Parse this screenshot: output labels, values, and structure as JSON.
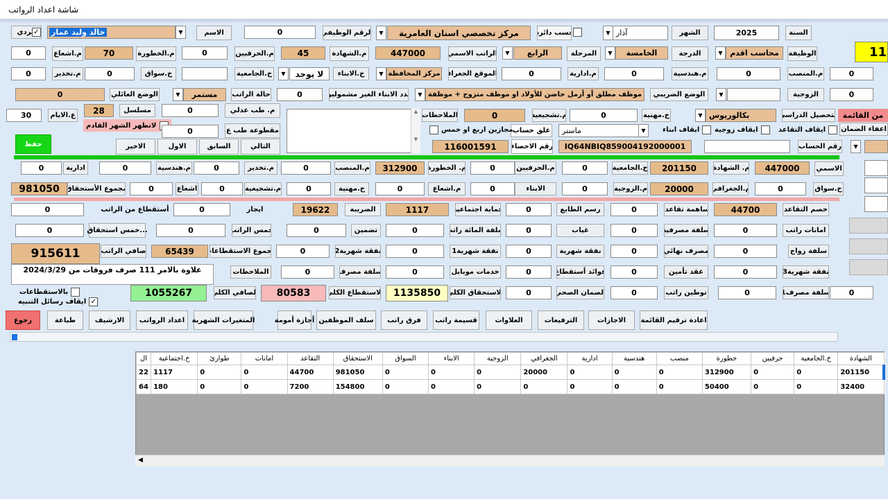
{
  "window": {
    "title": "شاشة اعداد الرواتب"
  },
  "top": {
    "year_label": "السنة",
    "year": "2025",
    "month_label": "الشهر",
    "month": "آذار",
    "by_circle_label": "حسب دائرة",
    "dept": "مركز تخصصي اسنان العامرية",
    "job_no_label": "الرقم الوظيفي",
    "job_no": "0",
    "name_label": "الاسم",
    "name": "خالد وليد عمار",
    "individual_label": "فردي",
    "big_counter": "11"
  },
  "row2": {
    "job_label": "الوظيفة",
    "job": "محاسب اقدم",
    "grade_label": "الدرجة",
    "grade": "الخامسة",
    "stage_label": "المرحلة",
    "stage": "الرابع",
    "nominal_label": "الراتب الاسمي",
    "nominal": "447000",
    "cert_label": "م.الشهادة",
    "cert": "45",
    "crafts_label": "م.الحرفيين",
    "crafts": "0",
    "danger_label": "م.الخطورة",
    "danger": "70",
    "radiation_label": "م.اشعاع",
    "radiation": "0"
  },
  "row3": {
    "pos_label": "م.المنصب",
    "pos": "0",
    "pos_left": "0",
    "eng_label": "م.هندسية",
    "eng": "0",
    "admin_label": "م.ادارية",
    "admin": "0",
    "geo_label": "م.الموقع الجغرافي",
    "geo": "مركز المحافظة",
    "kids_label": "خ.الابناء",
    "kids": "لا يوجد",
    "univ_label": "خ.الجامعية",
    "driver_label": "خ.سواق",
    "driver": "0",
    "anesth_label": "م.تخدير",
    "anesth": "0",
    "anesth2": "0"
  },
  "row4": {
    "spouse_label": "الزوجية",
    "spouse": "0",
    "tax_label": "الوضع الضريبي",
    "tax_status": "موظف مطلق أو أرمل حاضن للأولاد او موظف متزوج + موظفة",
    "kids_not_label": "عدد الابناء الغير مشمولين",
    "kids_not": "0",
    "salary_state_label": "حالة الراتب",
    "salary_state": "مستمر",
    "family_label": "الوضع العائلي",
    "family": "0"
  },
  "row5": {
    "edu_label": "التحصيل الدراسي",
    "edu": "بكالوريوس",
    "prof_label": "خ.مهنية",
    "prof": "0",
    "encour_label": "م.تشجيعية",
    "encour": "0",
    "notes_label": "الملاحظات",
    "judicial_label": "م. طب عدلي",
    "judicial": "0",
    "serial_label": "مسلسل",
    "serial": "28",
    "days_label": "ع.الايام",
    "days": "30",
    "hide_prev_label": "لاتظهر الشهر القادم",
    "cut_label": "مقطوعة طب ع",
    "cut": "0",
    "exempt_label": "اعفاء الضمان",
    "list_tag": "من القائمة"
  },
  "row6": {
    "stop_ret_label": "ايقاف التقاعد",
    "stop_spouse_label": "ايقاف زوجية",
    "stop_kids_label": "ايقاف ابناء",
    "degree2": "ماستر",
    "close_calc_label": "غلق حساب",
    "leave_label": "مجازين اربع او خمس",
    "account_label": "رقم الحساب",
    "iban": "IQ64NBIQ859004192000001",
    "stat_label": "رقم الاحصاء",
    "stat": "116001591"
  },
  "nav": {
    "save": "حفظ",
    "next": "التالي",
    "prev": "السابق",
    "first": "الاول",
    "last": "الاخير"
  },
  "calc1": {
    "nominal_label": "الاسمي",
    "nominal": "447000",
    "cert_label": "م. الشهادة",
    "cert": "201150",
    "univ_label": "خ.الجامعية",
    "univ": "0",
    "crafts_label": "م.الحرفيين",
    "crafts": "0",
    "danger_label": "م. الخطورة",
    "danger": "312900",
    "pos_label": "م.المنصب",
    "pos": "0",
    "anesth_label": "م.تخدير",
    "anesth": "0",
    "eng_label": "م.هندسية",
    "eng": "0",
    "admin_label": "ادارية",
    "admin": "0"
  },
  "calc2": {
    "driver_label": "خ.سواق",
    "driver": "0",
    "geo_label": "م.الجغرافي",
    "geo": "20000",
    "spouse_label": "م.الزوجية",
    "spouse": "0",
    "kids_label": "الابناء",
    "kids": "0",
    "radiation_label": "م.اشعاع",
    "radiation": "0",
    "prof_label": "خ.مهنية",
    "prof": "0",
    "encour_label": "م.تشجيعية",
    "encour": "0",
    "rad2_label": "اشعاع",
    "rad2": "0",
    "total_label": "مجموع الأستحقاق",
    "total": "981050"
  },
  "ded": {
    "retire_label": "خصم التقاعد",
    "retire": "44700",
    "retire_contrib_label": "مساهمة تقاعدية",
    "retire_contrib": "0",
    "stamp_label": "رسم الطابع",
    "stamp": "0",
    "social_label": "حماية اجتماعية",
    "social": "1117",
    "tax_label": "الضريبة",
    "tax": "19622",
    "rent_label": "ايجار",
    "rent": "0",
    "salary_ded_label": "أستقطاع من الراتب",
    "salary_ded": "0",
    "trust_label": "امانات راتب",
    "trust": "0",
    "bank_loan_label": "سلفة مصرفية",
    "bank_loan": "0",
    "absence_label": "غياب",
    "absence": "0",
    "loan100_label": "سلفة المائة راتب",
    "loan100": "0",
    "insure_label": "تضمين",
    "insure": "0",
    "fifth_label": "خمس الراتب",
    "fifth": "0",
    "fifth_due_label": "خمس استحقاق...",
    "fifth_due": "0",
    "marriage_label": "سلفة زواج",
    "marriage": "0",
    "final_exp_label": "مصرف نهائي",
    "final_exp": "0",
    "monthly_label": "نفقة شهرية",
    "monthly": "0",
    "monthly1_label": "نفقة شهرية1",
    "monthly1": "0",
    "monthly2_label": "نفقة شهرية2",
    "monthly2": "0",
    "total_ded_label": "مجموع الاستقطاعات",
    "total_ded": "65439",
    "net_label": "صافي الراتب",
    "net": "915611",
    "monthly3_label": "نفقة شهرية3",
    "monthly3": "0",
    "ins_contract_label": "عقد تأمين",
    "ins_contract": "0",
    "ded_interest_label": "فوائد أستقطاع",
    "ded_interest": "0",
    "mobile_label": "خدمات موبايل",
    "mobile": "0",
    "bank_exp_label": "سلفة مصرف",
    "bank_exp": "0",
    "notes_label": "الملاحظات",
    "note": "علاوة بالامر 111 صرف فروقات من 2024/3/29",
    "loan1_label": "سلفة مصرف1",
    "loan1": "0",
    "loan1_b": "0",
    "localize_label": "توطين راتب",
    "localize": "0",
    "health_label": "الضمان الصحي",
    "health": "0",
    "total_due_label": "الاستحقاق الكلي",
    "total_due": "1135850",
    "total_ded2_label": "الاستقطاع الكلي",
    "total_ded2": "80583",
    "total_net_label": "الصافي الكلي",
    "total_net": "1055267",
    "with_ded_label": "بالاستقطاعات",
    "stop_alerts_label": "ايقاف رسائل التنبيه"
  },
  "actions": [
    "اعادة ترقيم القائمة",
    "الاجازات",
    "الترفيعات",
    "العلاوات",
    "قسيمة راتب",
    "فرق راتب",
    "سلف الموظفين",
    "أجازة أمومة",
    "المتغيرات الشهرية",
    "اعداد الرواتب",
    "الارشيف",
    "طباعة",
    "رجوع"
  ],
  "table": {
    "columns": [
      "الشهادة",
      "خ.الجامعية",
      "حرفيين",
      "خطورة",
      "منصب",
      "هندسية",
      "ادارية",
      "الجغرافي",
      "الزوجية",
      "الابناء",
      "السواق",
      "الاستحقاق",
      "التقاعد",
      "امانات",
      "طوارئ",
      "خ.اجتماعية",
      "ال"
    ],
    "rows": [
      [
        "201150",
        "0",
        "0",
        "312900",
        "0",
        "0",
        "0",
        "20000",
        "0",
        "0",
        "0",
        "981050",
        "44700",
        "0",
        "0",
        "1117",
        "22"
      ],
      [
        "32400",
        "0",
        "0",
        "50400",
        "0",
        "0",
        "0",
        "0",
        "0",
        "0",
        "0",
        "154800",
        "7200",
        "0",
        "0",
        "180",
        "64"
      ]
    ]
  },
  "colors": {
    "tan": "#e8bf96",
    "green": "#16c616",
    "pink": "#f7b9b9",
    "yellow": "#ffff00",
    "return_btn": "#f07070"
  }
}
